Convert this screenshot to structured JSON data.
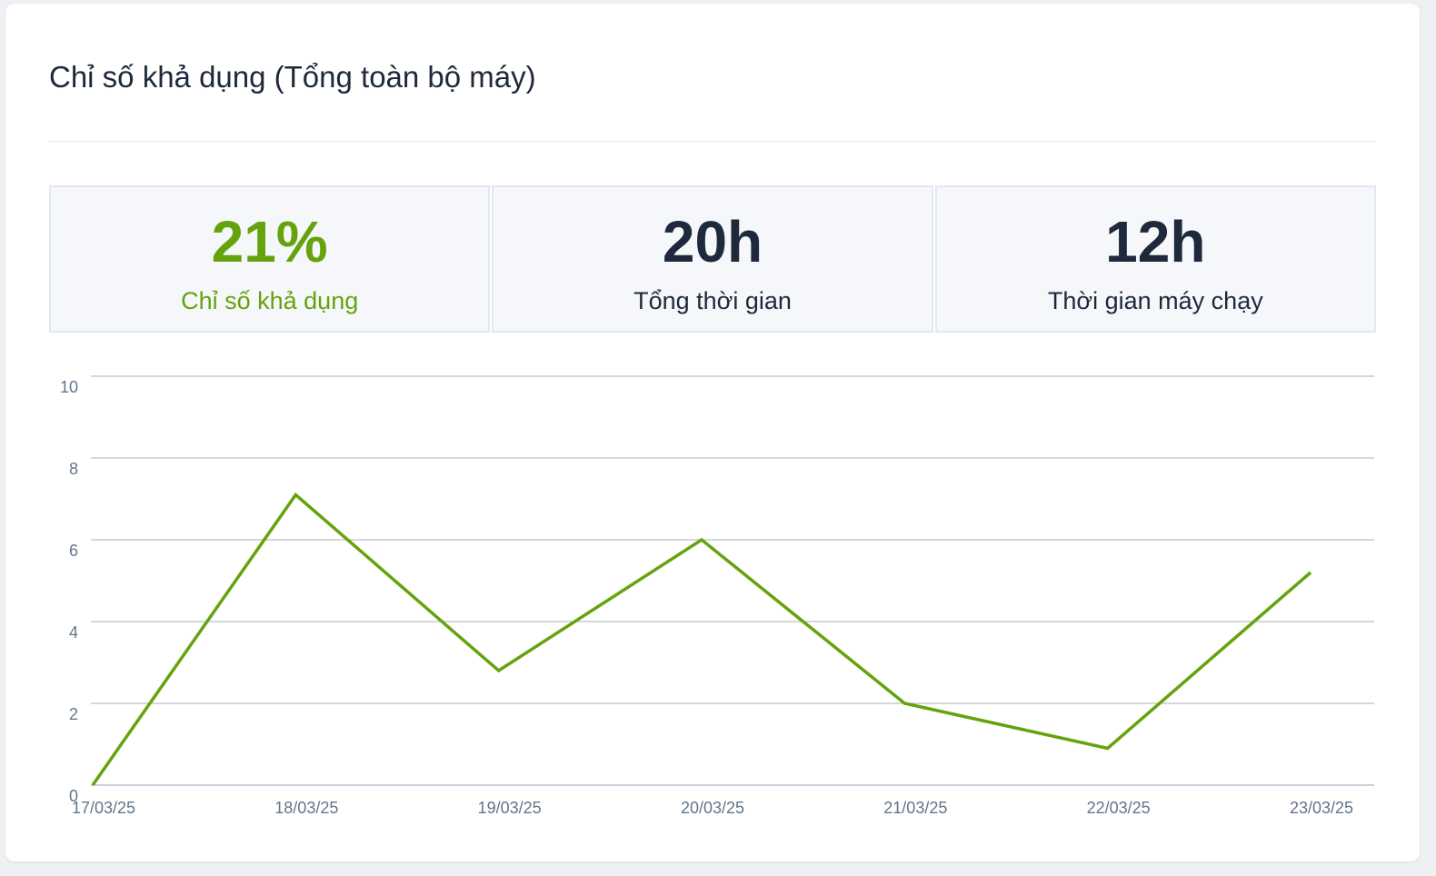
{
  "title": "Chỉ số khả dụng (Tổng toàn bộ máy)",
  "stats": [
    {
      "value": "21%",
      "label": "Chỉ số khả dụng",
      "color": "#65a30d"
    },
    {
      "value": "20h",
      "label": "Tổng thời gian",
      "color": "#1e293b"
    },
    {
      "value": "12h",
      "label": "Thời gian máy chạy",
      "color": "#1e293b"
    }
  ],
  "chart_data": {
    "type": "line",
    "title": "",
    "xlabel": "",
    "ylabel": "",
    "x": [
      "17/03/25",
      "18/03/25",
      "19/03/25",
      "20/03/25",
      "21/03/25",
      "22/03/25",
      "23/03/25"
    ],
    "series": [
      {
        "values": [
          0,
          7.1,
          2.8,
          6.0,
          2.0,
          0.9,
          5.2
        ],
        "color": "#65a30d"
      }
    ],
    "yticks": [
      0,
      2,
      4,
      6,
      8,
      10
    ],
    "ylim": [
      0,
      10
    ],
    "grid": true,
    "legend": "none"
  }
}
